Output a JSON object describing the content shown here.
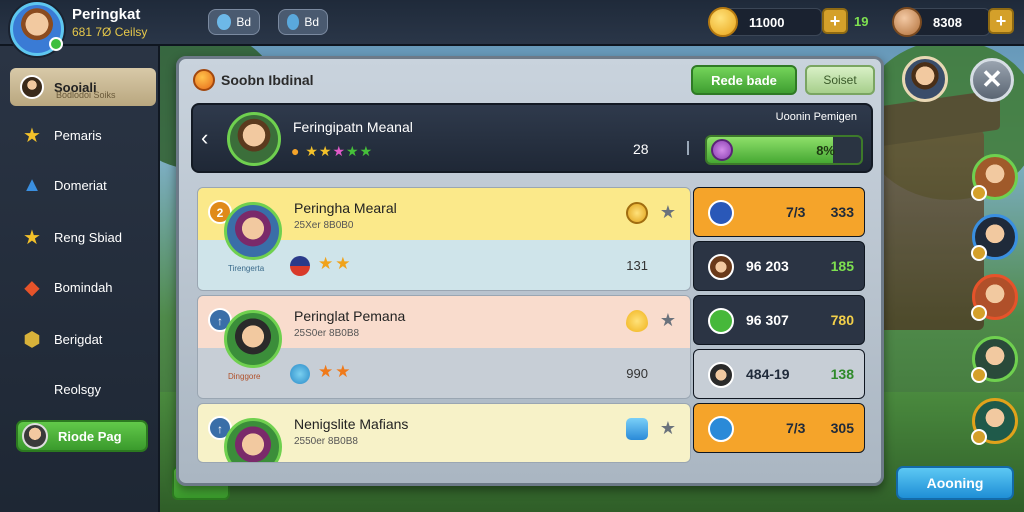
{
  "topbar": {
    "player_name": "Peringkat",
    "player_sub": "681 7Ø Ceilsy",
    "tab1": "Bd",
    "tab2": "Bd",
    "coins": "11000",
    "green_value": "19",
    "gems": "8308"
  },
  "sidebar": {
    "items": [
      {
        "label": "Sooiali",
        "sub": "Bodlodoi Soiks",
        "icon": "avatar-icon",
        "active": true
      },
      {
        "label": "Pemaris",
        "icon": "star-icon"
      },
      {
        "label": "Domeriat",
        "icon": "triangle-icon"
      },
      {
        "label": "Reng Sbiad",
        "icon": "star-icon"
      },
      {
        "label": "Bomindah",
        "icon": "heart-icon"
      },
      {
        "label": "Berigdat",
        "icon": "shield-icon"
      },
      {
        "label": "Reolsgy",
        "icon": ""
      }
    ],
    "bottom_button": "Riode Pag"
  },
  "panel": {
    "title": "Soobn Ibdinal",
    "button_primary": "Rede bade",
    "button_secondary": "Soiset",
    "featured": {
      "name": "Feringipatn Meanal",
      "label": "Uoonin Pemigen",
      "rank": "28",
      "progress_text": "8%",
      "progress_fraction": 0.82
    },
    "rows": [
      {
        "name": "Peringha Mearal",
        "sub": "25Xer 8B0B0",
        "caption": "Tirengerta",
        "score": "131",
        "stat_top": {
          "a": "7/3",
          "b": "333"
        },
        "stat_bottom": {
          "a": "96 203",
          "b": "185"
        }
      },
      {
        "name": "Peringlat Pemana",
        "sub": "25S0er 8B0B8",
        "caption": "Dinggore",
        "score": "990",
        "stat_top": {
          "a": "96 307",
          "b": "780"
        },
        "stat_bottom": {
          "a": "484-19",
          "b": "138"
        }
      },
      {
        "name": "Nenigslite Mafians",
        "sub": "2550er 8B0B8",
        "caption": "",
        "score": "",
        "stat_top": {
          "a": "7/3",
          "b": "305"
        },
        "stat_bottom": {
          "a": "",
          "b": ""
        }
      }
    ]
  },
  "right": {
    "anchor_button": "Aooning"
  },
  "colors": {
    "accent_green": "#4fb23a",
    "accent_blue": "#1f8ed6",
    "row1_upper": "#fbe98a",
    "row1_lower": "#cfe4ea",
    "row2_upper": "#f9dccd",
    "row2_lower": "#c7ced6",
    "row3_upper": "#f7f2c8",
    "stat_orange": "#f5a42a",
    "stat_dark": "#2b3444"
  }
}
